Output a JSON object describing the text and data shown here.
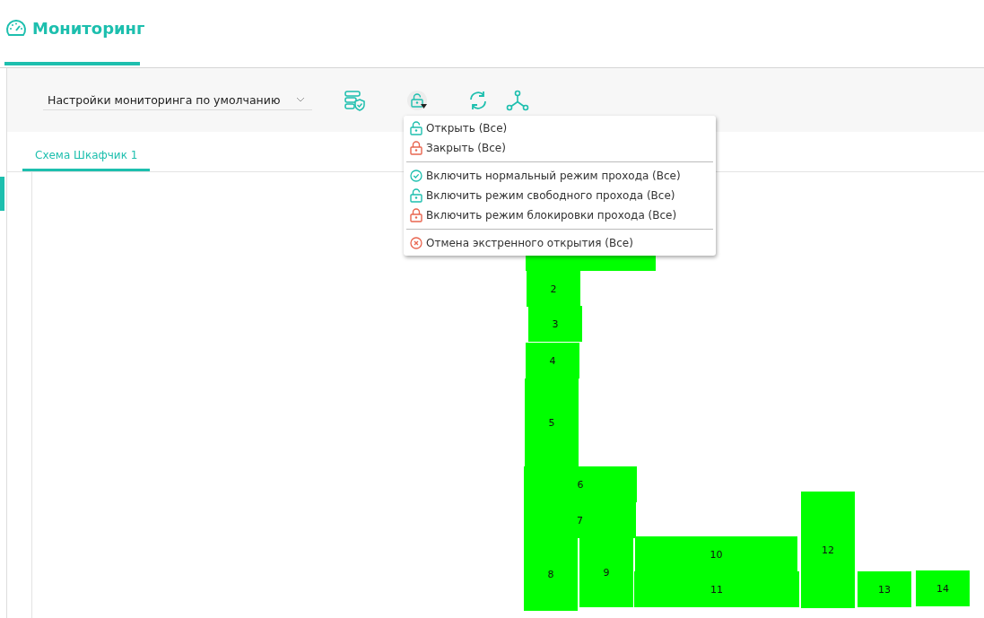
{
  "page": {
    "title": "Мониторинг"
  },
  "toolbar": {
    "profile_select": {
      "value": "Настройки мониторинга по умолчанию"
    }
  },
  "lock_menu": {
    "items": [
      {
        "kind": "unlock",
        "label": "Открыть (Все)"
      },
      {
        "kind": "lock",
        "label": "Закрыть (Все)"
      },
      {
        "kind": "separator"
      },
      {
        "kind": "check",
        "label": "Включить нормальный режим прохода (Все)"
      },
      {
        "kind": "unlock",
        "label": "Включить режим свободного прохода (Все)"
      },
      {
        "kind": "lock",
        "label": "Включить режим блокировки прохода (Все)"
      },
      {
        "kind": "separator"
      },
      {
        "kind": "cancel",
        "label": "Отмена экстренного открытия (Все)"
      }
    ]
  },
  "tabs": [
    {
      "label": "Схема Шкафчик 1",
      "selected": true
    }
  ],
  "scheme": {
    "cells": [
      {},
      {
        "label": "2"
      },
      {
        "label": "3"
      },
      {
        "label": "4"
      },
      {
        "label": "5"
      },
      {
        "label": "6"
      },
      {
        "label": "7"
      },
      {
        "label": "8"
      },
      {
        "label": "9"
      },
      {
        "label": "10"
      },
      {
        "label": "11"
      },
      {
        "label": "12"
      },
      {
        "label": "13"
      },
      {
        "label": "14"
      }
    ]
  }
}
